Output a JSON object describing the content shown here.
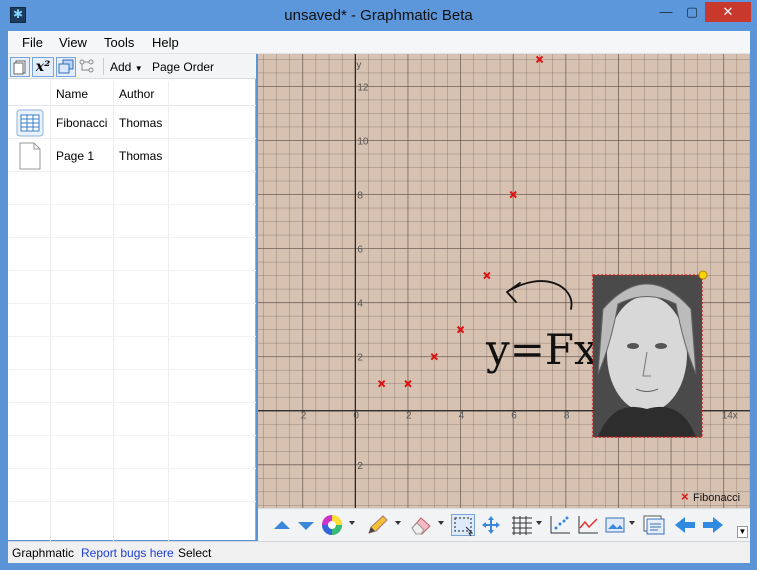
{
  "window": {
    "title": "unsaved* - Graphmatic Beta",
    "min_glyph": "—",
    "max_glyph": "▢",
    "close_glyph": "✕"
  },
  "menu": {
    "items": [
      "File",
      "View",
      "Tools",
      "Help"
    ]
  },
  "toolbar": {
    "add_label": "Add",
    "page_order_label": "Page Order"
  },
  "table": {
    "headers": [
      "Name",
      "Author"
    ],
    "rows": [
      {
        "name": "Fibonacci",
        "author": "Thomas",
        "icon": "table-icon"
      },
      {
        "name": "Page 1",
        "author": "Thomas",
        "icon": "page-icon"
      }
    ]
  },
  "chart_data": {
    "type": "scatter",
    "x_ticks": [
      "2",
      "0",
      "2",
      "4",
      "6",
      "8",
      "14x"
    ],
    "y_ticks": [
      "12",
      "10",
      "8",
      "6",
      "4",
      "2",
      "2"
    ],
    "ylabel": "y",
    "xlim": [
      -3.7,
      15
    ],
    "ylim": [
      -3.6,
      13.2
    ],
    "series": [
      {
        "name": "Fibonacci",
        "color": "#e01010",
        "marker": "x",
        "points": [
          [
            1,
            1
          ],
          [
            2,
            1
          ],
          [
            3,
            2
          ],
          [
            4,
            3
          ],
          [
            5,
            5
          ],
          [
            6,
            8
          ],
          [
            7,
            13
          ]
        ]
      }
    ],
    "annotation": "y=Fx",
    "legend_position": "bottom-right",
    "grid": true
  },
  "status": {
    "app": "Graphmatic",
    "link": "Report bugs here",
    "mode": "Select"
  },
  "colors": {
    "canvas_bg": "#d7c2b2",
    "grid_minor": "#5a4a40",
    "marker": "#e01010",
    "accent": "#2f7ad8"
  }
}
